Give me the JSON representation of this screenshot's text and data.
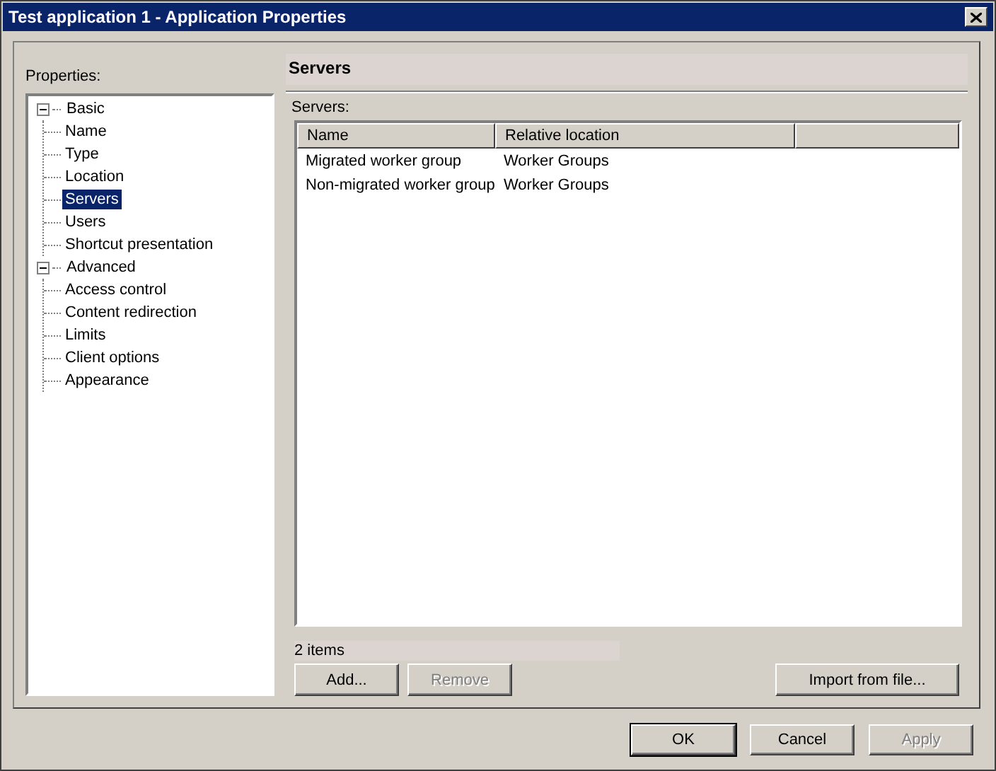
{
  "window": {
    "title": "Test application 1 - Application Properties"
  },
  "properties_label": "Properties:",
  "tree": [
    {
      "label": "Basic",
      "expanded": true,
      "selected": false,
      "children": [
        {
          "label": "Name",
          "selected": false
        },
        {
          "label": "Type",
          "selected": false
        },
        {
          "label": "Location",
          "selected": false
        },
        {
          "label": "Servers",
          "selected": true
        },
        {
          "label": "Users",
          "selected": false
        },
        {
          "label": "Shortcut presentation",
          "selected": false
        }
      ]
    },
    {
      "label": "Advanced",
      "expanded": true,
      "selected": false,
      "children": [
        {
          "label": "Access control",
          "selected": false
        },
        {
          "label": "Content redirection",
          "selected": false
        },
        {
          "label": "Limits",
          "selected": false
        },
        {
          "label": "Client options",
          "selected": false
        },
        {
          "label": "Appearance",
          "selected": false
        }
      ]
    }
  ],
  "page": {
    "heading": "Servers",
    "list_label": "Servers:",
    "table": {
      "columns": [
        "Name",
        "Relative location"
      ],
      "rows": [
        [
          "Migrated worker group",
          "Worker Groups"
        ],
        [
          "Non-migrated worker group",
          "Worker Groups"
        ]
      ]
    },
    "count": "2 items",
    "buttons": [
      {
        "label": "Add...",
        "disabled": false
      },
      {
        "label": "Remove",
        "disabled": true
      },
      {
        "label": "Import from file...",
        "disabled": false
      }
    ]
  },
  "buttons": [
    {
      "label": "OK",
      "disabled": false,
      "default": true
    },
    {
      "label": "Cancel",
      "disabled": false,
      "default": false
    },
    {
      "label": "Apply",
      "disabled": true,
      "default": false
    }
  ]
}
